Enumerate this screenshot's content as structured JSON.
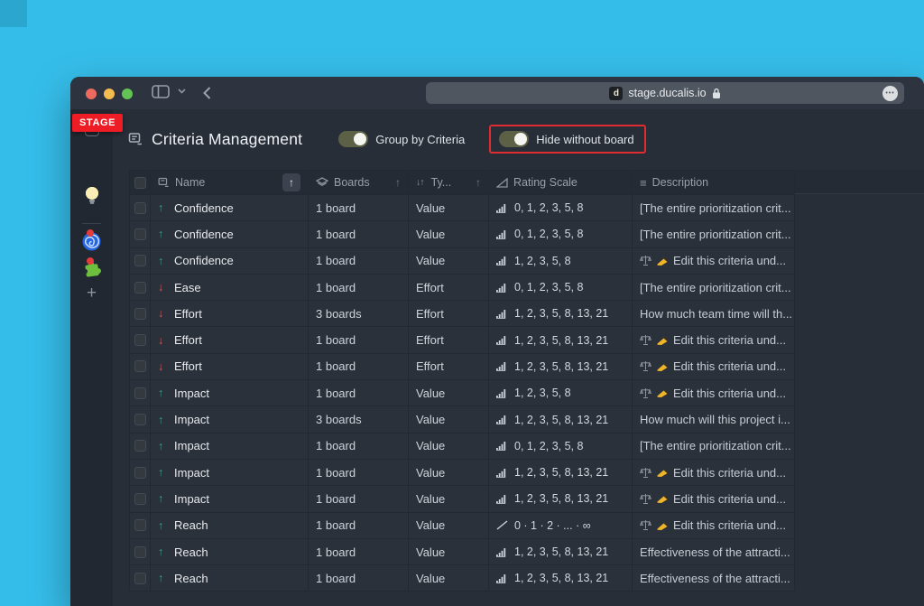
{
  "browser": {
    "url": "stage.ducalis.io",
    "favicon_letter": "d",
    "ellipsis": "•••"
  },
  "stage_badge": "STAGE",
  "page": {
    "title": "Criteria Management",
    "group_toggle_label": "Group by Criteria",
    "hide_toggle_label": "Hide without board"
  },
  "sidebar": {
    "items": [
      "app-square",
      "bulb",
      "spiral",
      "puzzle",
      "add"
    ],
    "notification_color": "#e23c3c"
  },
  "colors": {
    "desktop": "#35bde9",
    "window": "#272e38",
    "row": "#2a313b",
    "header": "#242b34",
    "toggle_track": "#5c6045",
    "annotation_red": "#e02b30",
    "up_green": "#3da183",
    "down_red": "#dd5858"
  },
  "table": {
    "headers": {
      "name": "Name",
      "boards": "Boards",
      "type": "Ty...",
      "rating": "Rating Scale",
      "description": "Description"
    },
    "rows": [
      {
        "dir": "up",
        "name": "Confidence",
        "boards": "1 board",
        "type": "Value",
        "scale_icon": "bars",
        "scale": "0, 1, 2, 3, 5, 8",
        "desc_icons": false,
        "desc": "[The entire prioritization crit..."
      },
      {
        "dir": "up",
        "name": "Confidence",
        "boards": "1 board",
        "type": "Value",
        "scale_icon": "bars",
        "scale": "0, 1, 2, 3, 5, 8",
        "desc_icons": false,
        "desc": "[The entire prioritization crit..."
      },
      {
        "dir": "up",
        "name": "Confidence",
        "boards": "1 board",
        "type": "Value",
        "scale_icon": "bars",
        "scale": "1, 2, 3, 5, 8",
        "desc_icons": true,
        "desc": "Edit this criteria und..."
      },
      {
        "dir": "down",
        "name": "Ease",
        "boards": "1 board",
        "type": "Effort",
        "scale_icon": "bars",
        "scale": "0, 1, 2, 3, 5, 8",
        "desc_icons": false,
        "desc": "[The entire prioritization crit..."
      },
      {
        "dir": "down",
        "name": "Effort",
        "boards": "3 boards",
        "type": "Effort",
        "scale_icon": "bars",
        "scale": "1, 2, 3, 5, 8, 13, 21",
        "desc_icons": false,
        "desc": "How much team time will th..."
      },
      {
        "dir": "down",
        "name": "Effort",
        "boards": "1 board",
        "type": "Effort",
        "scale_icon": "bars",
        "scale": "1, 2, 3, 5, 8, 13, 21",
        "desc_icons": true,
        "desc": "Edit this criteria und..."
      },
      {
        "dir": "down",
        "name": "Effort",
        "boards": "1 board",
        "type": "Effort",
        "scale_icon": "bars",
        "scale": "1, 2, 3, 5, 8, 13, 21",
        "desc_icons": true,
        "desc": "Edit this criteria und..."
      },
      {
        "dir": "up",
        "name": "Impact",
        "boards": "1 board",
        "type": "Value",
        "scale_icon": "bars",
        "scale": "1, 2, 3, 5, 8",
        "desc_icons": true,
        "desc": "Edit this criteria und..."
      },
      {
        "dir": "up",
        "name": "Impact",
        "boards": "3 boards",
        "type": "Value",
        "scale_icon": "bars",
        "scale": "1, 2, 3, 5, 8, 13, 21",
        "desc_icons": false,
        "desc": "How much will this project i..."
      },
      {
        "dir": "up",
        "name": "Impact",
        "boards": "1 board",
        "type": "Value",
        "scale_icon": "bars",
        "scale": "0, 1, 2, 3, 5, 8",
        "desc_icons": false,
        "desc": "[The entire prioritization crit..."
      },
      {
        "dir": "up",
        "name": "Impact",
        "boards": "1 board",
        "type": "Value",
        "scale_icon": "bars",
        "scale": "1, 2, 3, 5, 8, 13, 21",
        "desc_icons": true,
        "desc": "Edit this criteria und..."
      },
      {
        "dir": "up",
        "name": "Impact",
        "boards": "1 board",
        "type": "Value",
        "scale_icon": "bars",
        "scale": "1, 2, 3, 5, 8, 13, 21",
        "desc_icons": true,
        "desc": "Edit this criteria und..."
      },
      {
        "dir": "up",
        "name": "Reach",
        "boards": "1 board",
        "type": "Value",
        "scale_icon": "line",
        "scale": "0 · 1 · 2 · ... · ∞",
        "desc_icons": true,
        "desc": "Edit this criteria und..."
      },
      {
        "dir": "up",
        "name": "Reach",
        "boards": "1 board",
        "type": "Value",
        "scale_icon": "bars",
        "scale": "1, 2, 3, 5, 8, 13, 21",
        "desc_icons": false,
        "desc": "Effectiveness of the attracti..."
      },
      {
        "dir": "up",
        "name": "Reach",
        "boards": "1 board",
        "type": "Value",
        "scale_icon": "bars",
        "scale": "1, 2, 3, 5, 8, 13, 21",
        "desc_icons": false,
        "desc": "Effectiveness of the attracti..."
      }
    ]
  }
}
